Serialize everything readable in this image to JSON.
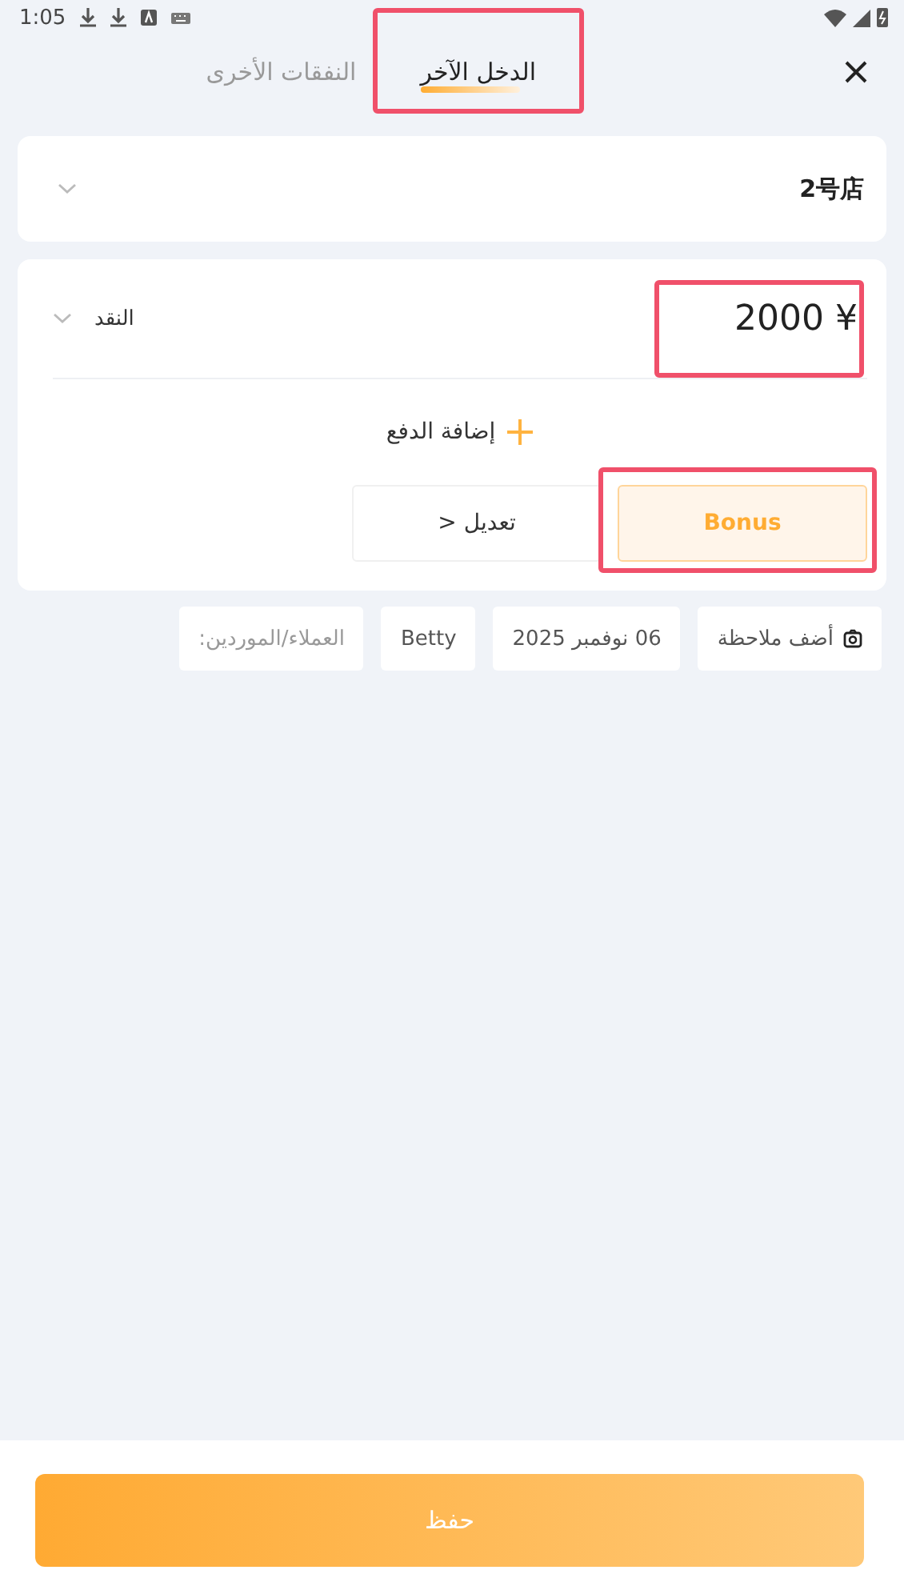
{
  "status_bar": {
    "time": "1:05"
  },
  "tabs": [
    {
      "label": "الدخل الآخر",
      "selected": true,
      "highlighted": true
    },
    {
      "label": "النفقات الأخرى",
      "selected": false,
      "highlighted": false
    }
  ],
  "store": {
    "value": "2号店"
  },
  "payment": {
    "currency": "¥",
    "amount": "2000",
    "amount_highlighted": true,
    "method": "النقد"
  },
  "add_payment": "إضافة الدفع",
  "payment_buttons": [
    {
      "label": "Bonus",
      "selected": true,
      "highlighted": true
    },
    {
      "label": "> تعديل",
      "selected": false,
      "highlighted": false
    }
  ],
  "chips": [
    {
      "kind": "note",
      "label": "أضف ملاحظة"
    },
    {
      "kind": "text",
      "label": "06 نوفمبر 2025"
    },
    {
      "kind": "text",
      "label": "Betty"
    },
    {
      "kind": "placeholder",
      "label": "العملاء/الموردين:"
    }
  ],
  "save_button": "حفظ"
}
